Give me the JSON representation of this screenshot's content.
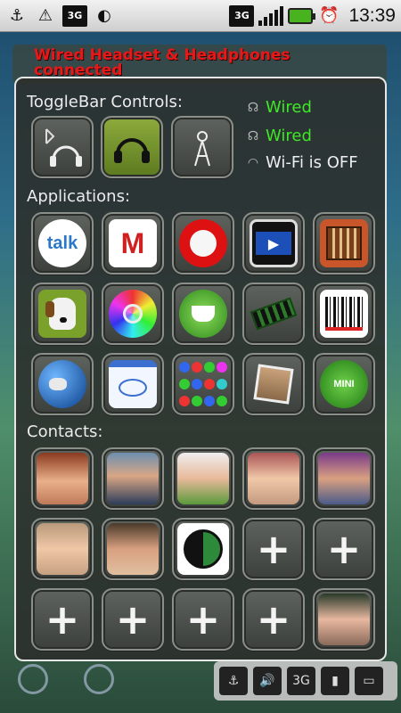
{
  "status_bar": {
    "time": "13:39",
    "network_label": "3G",
    "icons": [
      "usb-icon",
      "warning-icon",
      "3g-signal-icon",
      "speaker-icon",
      "3g-data-icon",
      "signal-icon",
      "battery-icon",
      "alarm-icon"
    ]
  },
  "notification": {
    "text": "Wired Headset & Headphones connected"
  },
  "panel": {
    "togglebar_label": "ToggleBar Controls:",
    "applications_label": "Applications:",
    "contacts_label": "Contacts:"
  },
  "status": {
    "line1": "Wired",
    "line2": "Wired",
    "line3": "Wi-Fi is OFF"
  },
  "toggles": [
    {
      "icon": "bluetooth-headphones-icon"
    },
    {
      "icon": "headphones-icon",
      "active": true
    },
    {
      "icon": "antenna-icon"
    }
  ],
  "apps": [
    {
      "icon": "talk-icon",
      "text": "talk"
    },
    {
      "icon": "gmail-icon",
      "text": "M"
    },
    {
      "icon": "record-icon"
    },
    {
      "icon": "video-player-icon"
    },
    {
      "icon": "library-icon"
    },
    {
      "icon": "dog-icon"
    },
    {
      "icon": "color-picker-icon"
    },
    {
      "icon": "android-coffee-icon"
    },
    {
      "icon": "memory-card-icon"
    },
    {
      "icon": "barcode-scanner-icon"
    },
    {
      "icon": "globe-icon"
    },
    {
      "icon": "calendar-icon"
    },
    {
      "icon": "bubbles-game-icon"
    },
    {
      "icon": "photo-gallery-icon"
    },
    {
      "icon": "mini-app-icon",
      "text": "MINI"
    }
  ],
  "contacts": [
    {
      "type": "photo"
    },
    {
      "type": "photo"
    },
    {
      "type": "photo"
    },
    {
      "type": "photo"
    },
    {
      "type": "photo"
    },
    {
      "type": "photo"
    },
    {
      "type": "photo"
    },
    {
      "type": "logo"
    },
    {
      "type": "add"
    },
    {
      "type": "add"
    },
    {
      "type": "add"
    },
    {
      "type": "add"
    },
    {
      "type": "add"
    },
    {
      "type": "add"
    },
    {
      "type": "photo"
    }
  ],
  "colors": {
    "accent_green": "#3ee826",
    "notification_red": "#e81818",
    "panel_border": "#e6e6e6"
  }
}
